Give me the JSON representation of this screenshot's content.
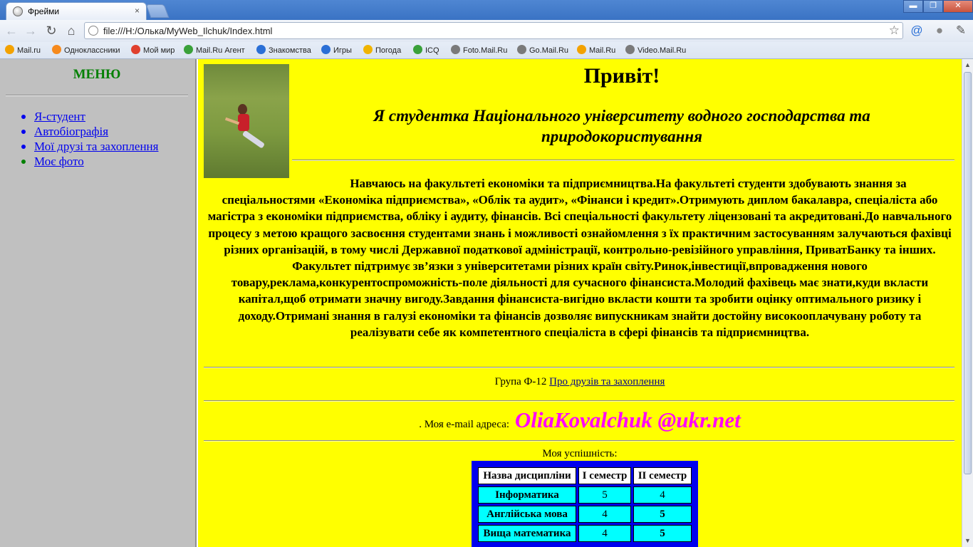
{
  "browser": {
    "tab_title": "Фрейми",
    "tab_close": "×",
    "url": "file:///H:/Олька/MyWeb_Ilchuk/Index.html",
    "window_controls": [
      "▬",
      "❐",
      "✕"
    ],
    "bookmarks": [
      {
        "label": "Mail.ru",
        "icon": "mailru-icon",
        "color": "#f3a200"
      },
      {
        "label": "Одноклассники",
        "icon": "odnoklassniki-icon",
        "color": "#f68a1e"
      },
      {
        "label": "Мой мир",
        "icon": "moymir-icon",
        "color": "#e0402e"
      },
      {
        "label": "Mail.Ru Агент",
        "icon": "agent-icon",
        "color": "#3aa13a"
      },
      {
        "label": "Знакомства",
        "icon": "znakomstva-icon",
        "color": "#2a6fd6"
      },
      {
        "label": "Игры",
        "icon": "games-icon",
        "color": "#2a6fd6"
      },
      {
        "label": "Погода",
        "icon": "weather-icon",
        "color": "#f0b400"
      },
      {
        "label": "ICQ",
        "icon": "icq-icon",
        "color": "#3aa13a"
      },
      {
        "label": "Foto.Mail.Ru",
        "icon": "globe-icon",
        "color": "#7a7a7a"
      },
      {
        "label": "Go.Mail.Ru",
        "icon": "globe-icon",
        "color": "#7a7a7a"
      },
      {
        "label": "Mail.Ru",
        "icon": "mailru-icon",
        "color": "#f3a200"
      },
      {
        "label": "Video.Mail.Ru",
        "icon": "globe-icon",
        "color": "#7a7a7a"
      }
    ]
  },
  "menu": {
    "title": "МЕНЮ",
    "items": [
      {
        "label": "Я-студент",
        "visited": false
      },
      {
        "label": "Автобіографія",
        "visited": false
      },
      {
        "label": "Мої друзі та захоплення",
        "visited": false
      },
      {
        "label": "Моє фото",
        "visited": true
      }
    ]
  },
  "content": {
    "greeting": "Привіт!",
    "subtitle": "Я студентка Національного університету водного господарства та природокористування",
    "paragraph": "Навчаюсь на факультеті економіки та підприємництва.На факультеті студенти здобувають знання за спеціальностями «Економіка підприємства», «Облік та аудит», «Фінанси і кредит».Отримують диплом бакалавра, спеціаліста або магістра з економіки підприємства, обліку і аудиту, фінансів. Всі спеціальності факультету ліцензовані та акредитовані.До навчального процесу з метою кращого засвоєння студентами знань і можливості ознайомлення з їх практичним застосуванням залучаються фахівці різних організацій, в тому числі Державної податкової адміністрації, контрольно-ревізійного управління, ПриватБанку та інших. Факультет підтримує зв’язки з університетами різних країн світу.Ринок,інвестиції,впровадження нового товару,реклама,конкурентоспроможність-поле діяльності для сучасного фінансиста.Молодий фахівець має знати,куди вкласти капітал,щоб отримати значну вигоду.Завдання фінансиста-вигідно вкласти кошти та зробити оцінку оптимального ризику і доходу.Отримані знання в галузі економіки та фінансів дозволяє випускникам знайти достойну високооплачувану роботу та реалізувати себе як компетентного спеціаліста в сфері фінансів та підприємництва.",
    "group_text": "Група Ф-12",
    "group_link": "Про друзів та захоплення",
    "email_label": ". Моя e-mail адреса:",
    "email": "OliaKovalchuk @ukr.net",
    "grades_caption": "Моя успішність:",
    "grades": {
      "headers": [
        "Назва дисципліни",
        "І семестр",
        "ІІ семестр"
      ],
      "rows": [
        [
          "Інформатика",
          "5",
          "4"
        ],
        [
          "Англійська мова",
          "4",
          "5"
        ],
        [
          "Вища математика",
          "4",
          "5"
        ]
      ]
    }
  }
}
